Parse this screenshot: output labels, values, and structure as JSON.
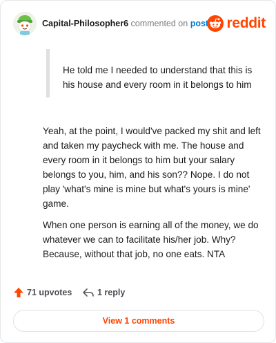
{
  "header": {
    "username": "Capital-Philosopher6",
    "action_text": "commented on",
    "post_link": "post",
    "brand_name": "reddit",
    "brand_color": "#ff4500"
  },
  "comment": {
    "quote": "He told me I needed to understand that this is his house and every room in it belongs to him",
    "paragraphs": [
      "Yeah, at the point, I would've packed my shit and left and taken my paycheck with me. The house and every room in it belongs to him but your salary belongs to you, him, and his son?? Nope. I do not play 'what's mine is mine but what's yours is mine' game.",
      "When one person is earning all of the money, we do whatever we can to facilitate his/her job. Why? Because, without that job, no one eats. NTA"
    ]
  },
  "actions": {
    "upvotes_label": "71 upvotes",
    "upvote_icon": "upvote-arrow-icon",
    "reply_label": "1 reply",
    "reply_icon": "reply-arrow-icon"
  },
  "view_button": {
    "label": "View 1 comments"
  },
  "icons": {
    "avatar": "snoo-avatar",
    "brand": "reddit-logo-icon"
  }
}
